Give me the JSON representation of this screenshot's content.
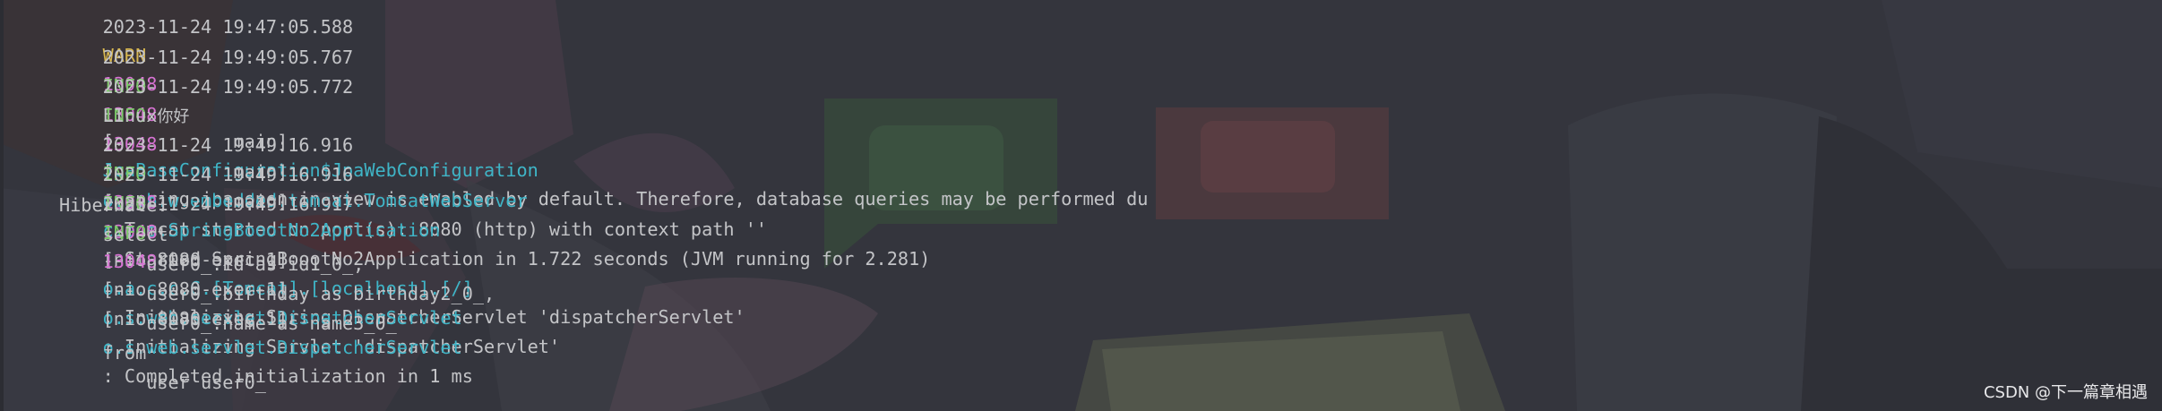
{
  "console": {
    "top_line": {
      "timestamp": "2023-11-24 19:47:05.588",
      "level": "WARN",
      "pid": "13048",
      "separator": "---",
      "thread": "[           main]",
      "logger": "JpaBaseConfiguration$JpaWebConfiguration",
      "message": ": spring.jpa.open-in-view is enabled by default. Therefore, database queries may be performed du"
    },
    "logs": [
      {
        "timestamp": "2023-11-24 19:49:05.767",
        "level": "INFO",
        "pid": "13048",
        "separator": "---",
        "thread": "[           main]",
        "logger": "o.s.b.w.embedded.tomcat.TomcatWebServer ",
        "message": ": Tomcat started on port(s): 8080 (http) with context path ''"
      },
      {
        "timestamp": "2023-11-24 19:49:05.772",
        "level": "INFO",
        "pid": "13048",
        "separator": "---",
        "thread": "[           main]",
        "logger": "c.e.s.SpringBoootNo2Application         ",
        "message": ": Started SpringBoootNo2Application in 1.722 seconds (JVM running for 2.281)"
      }
    ],
    "stdout_prefix": "LInux",
    "stdout_cjk": "你好",
    "logs2": [
      {
        "timestamp": "2023-11-24 19:49:16.916",
        "level": "INFO",
        "pid": "13048",
        "separator": "---",
        "thread": "[nio-8080-exec-1]",
        "logger": "o.a.c.c.C.[Tomcat].[localhost].[/]      ",
        "message": ": Initializing Spring DispatcherServlet 'dispatcherServlet'"
      },
      {
        "timestamp": "2023-11-24 19:49:16.916",
        "level": "INFO",
        "pid": "13048",
        "separator": "---",
        "thread": "[nio-8080-exec-1]",
        "logger": "o.s.web.servlet.DispatcherServlet       ",
        "message": ": Initializing Servlet 'dispatcherServlet'"
      },
      {
        "timestamp": "2023-11-24 19:49:16.917",
        "level": "INFO",
        "pid": "13048",
        "separator": "---",
        "thread": "[nio-8080-exec-1]",
        "logger": "o.s.web.servlet.DispatcherServlet       ",
        "message": ": Completed initialization in 1 ms"
      }
    ],
    "sql": [
      "Hibernate: ",
      "    select",
      "        user0_.id as id1_0_,",
      "        user0_.birthday as birthday2_0_,",
      "        user0_.name as name3_0_ ",
      "    from",
      "        user user0_ "
    ]
  },
  "watermark": "CSDN @下一篇章相遇",
  "colors": {
    "background": "#34353d",
    "info": "#7ccb6a",
    "warn": "#d7b64f",
    "pid": "#d673d2",
    "logger": "#3fb5c7",
    "text": "#c3c4c7"
  }
}
